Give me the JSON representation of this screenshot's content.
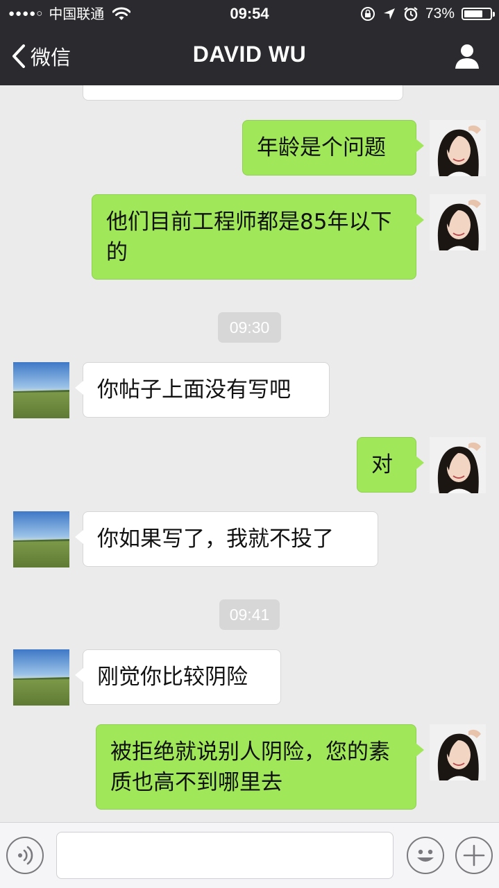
{
  "status_bar": {
    "signal_dots": "●●●●○",
    "carrier": "中国联通",
    "time": "09:54",
    "battery_percent": "73%",
    "battery_level": 0.73
  },
  "nav": {
    "back_label": "微信",
    "title": "DAVID WU"
  },
  "messages": [
    {
      "side": "in",
      "text": ""
    },
    {
      "side": "out",
      "text": "年龄是个问题"
    },
    {
      "side": "out",
      "text": "他们目前工程师都是85年以下的"
    },
    {
      "side": "time",
      "text": "09:30"
    },
    {
      "side": "in",
      "text": "你帖子上面没有写吧"
    },
    {
      "side": "out",
      "text": "对"
    },
    {
      "side": "in",
      "text": "你如果写了，我就不投了"
    },
    {
      "side": "time",
      "text": "09:41"
    },
    {
      "side": "in",
      "text": "刚觉你比较阴险"
    },
    {
      "side": "out",
      "text": "被拒绝就说别人阴险，您的素质也高不到哪里去"
    }
  ],
  "input_bar": {
    "voice_icon": "voice-icon",
    "emoji_icon": "emoji-icon",
    "add_icon": "plus-icon",
    "text_value": ""
  },
  "colors": {
    "nav_bg": "#2b2b2f",
    "chat_bg": "#ebebeb",
    "outgoing_bubble": "#a0e75a",
    "incoming_bubble": "#ffffff",
    "timestamp_bg": "#d7d7d7"
  }
}
